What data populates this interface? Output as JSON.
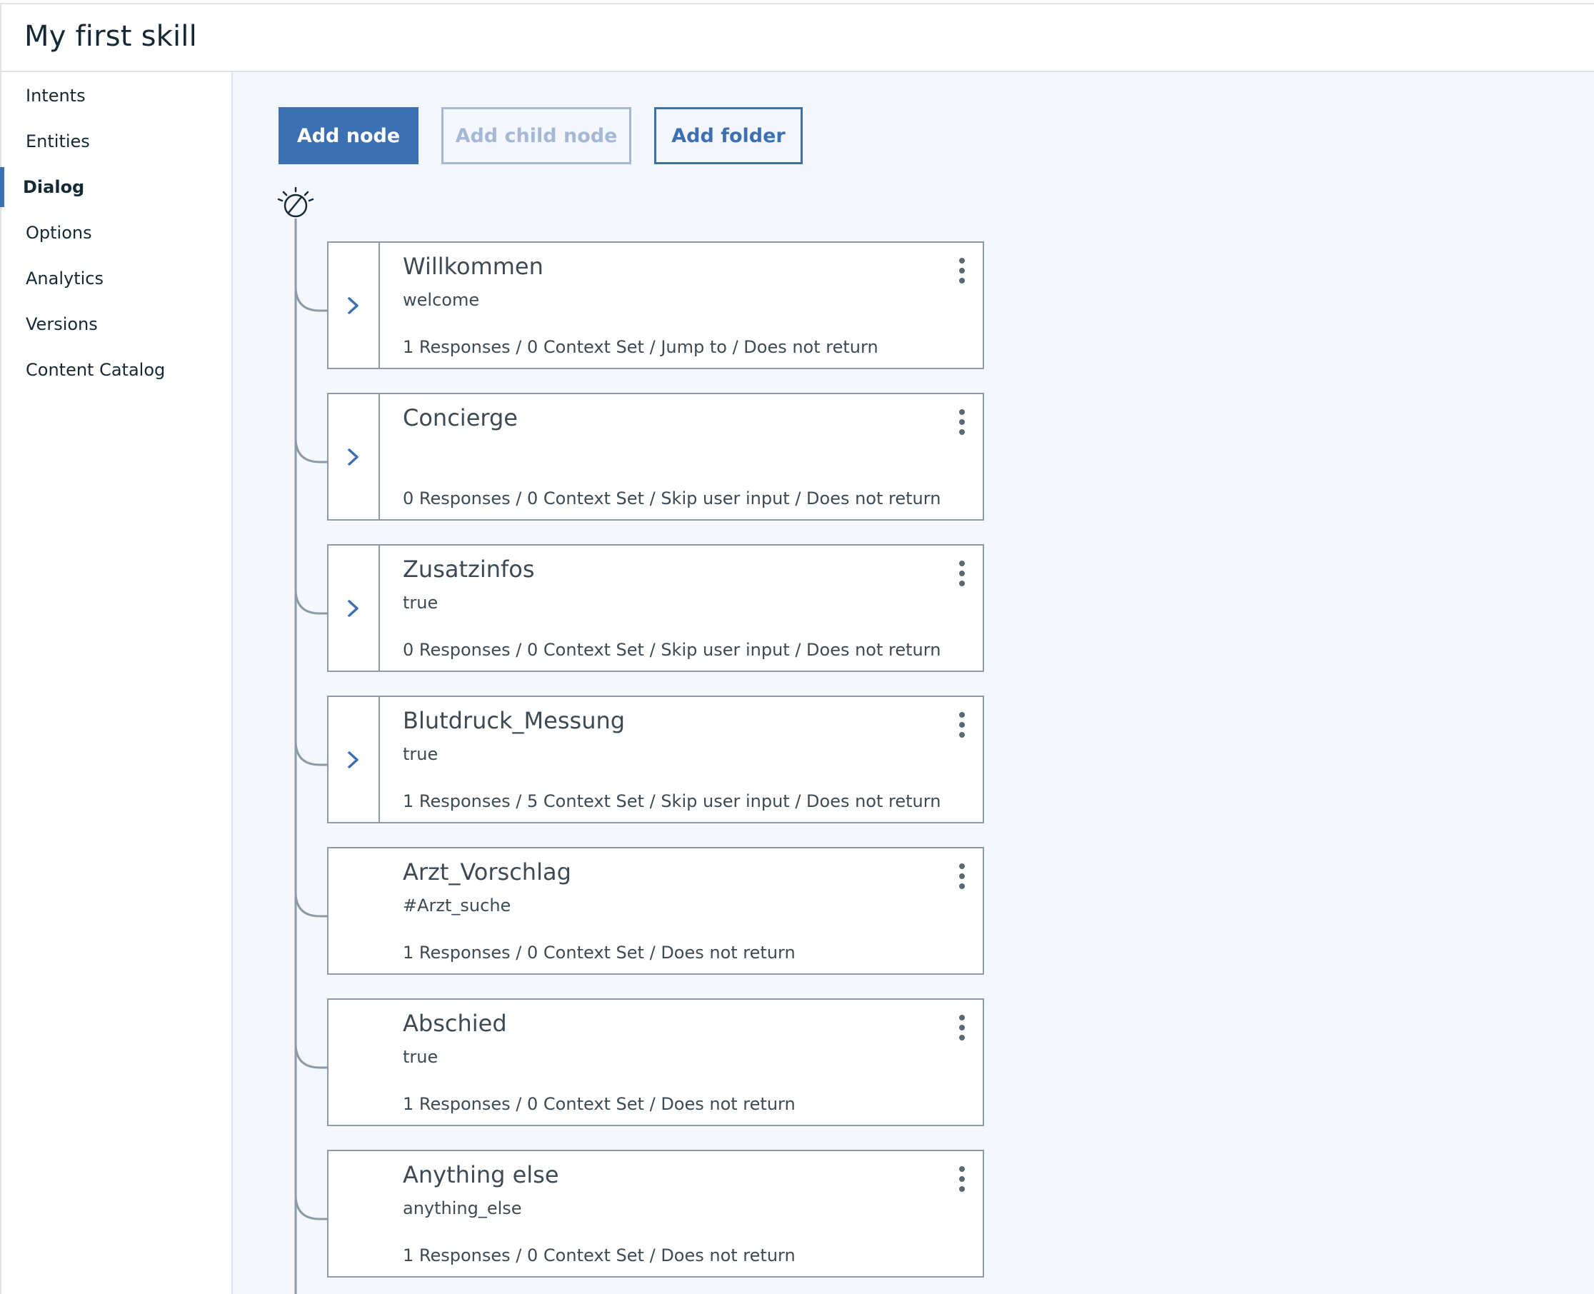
{
  "header": {
    "title": "My first skill"
  },
  "sidebar": {
    "items": [
      {
        "label": "Intents",
        "active": false
      },
      {
        "label": "Entities",
        "active": false
      },
      {
        "label": "Dialog",
        "active": true
      },
      {
        "label": "Options",
        "active": false
      },
      {
        "label": "Analytics",
        "active": false
      },
      {
        "label": "Versions",
        "active": false
      },
      {
        "label": "Content Catalog",
        "active": false
      }
    ]
  },
  "toolbar": {
    "add_node_label": "Add node",
    "add_child_node_label": "Add child node",
    "add_child_node_disabled": true,
    "add_folder_label": "Add folder"
  },
  "dialog": {
    "root_icon": "bulb-icon",
    "nodes": [
      {
        "title": "Willkommen",
        "condition": "welcome",
        "summary": "1 Responses / 0 Context Set / Jump to / Does not return",
        "has_children": true
      },
      {
        "title": "Concierge",
        "condition": "",
        "summary": "0 Responses / 0 Context Set / Skip user input / Does not return",
        "has_children": true
      },
      {
        "title": "Zusatzinfos",
        "condition": "true",
        "summary": "0 Responses / 0 Context Set / Skip user input / Does not return",
        "has_children": true
      },
      {
        "title": "Blutdruck_Messung",
        "condition": "true",
        "summary": "1 Responses / 5 Context Set / Skip user input / Does not return",
        "has_children": true
      },
      {
        "title": "Arzt_Vorschlag",
        "condition": "#Arzt_suche",
        "summary": "1 Responses / 0 Context Set / Does not return",
        "has_children": false
      },
      {
        "title": "Abschied",
        "condition": "true",
        "summary": "1 Responses / 0 Context Set / Does not return",
        "has_children": false
      },
      {
        "title": "Anything else",
        "condition": "anything_else",
        "summary": "1 Responses / 0 Context Set / Does not return",
        "has_children": false
      }
    ]
  },
  "colors": {
    "accent": "#3d70b2",
    "accent_disabled": "#a5b9d6",
    "main_background": "#f4f7fb",
    "node_border": "#8c9ba5",
    "tree_line": "#8c9ba5"
  }
}
